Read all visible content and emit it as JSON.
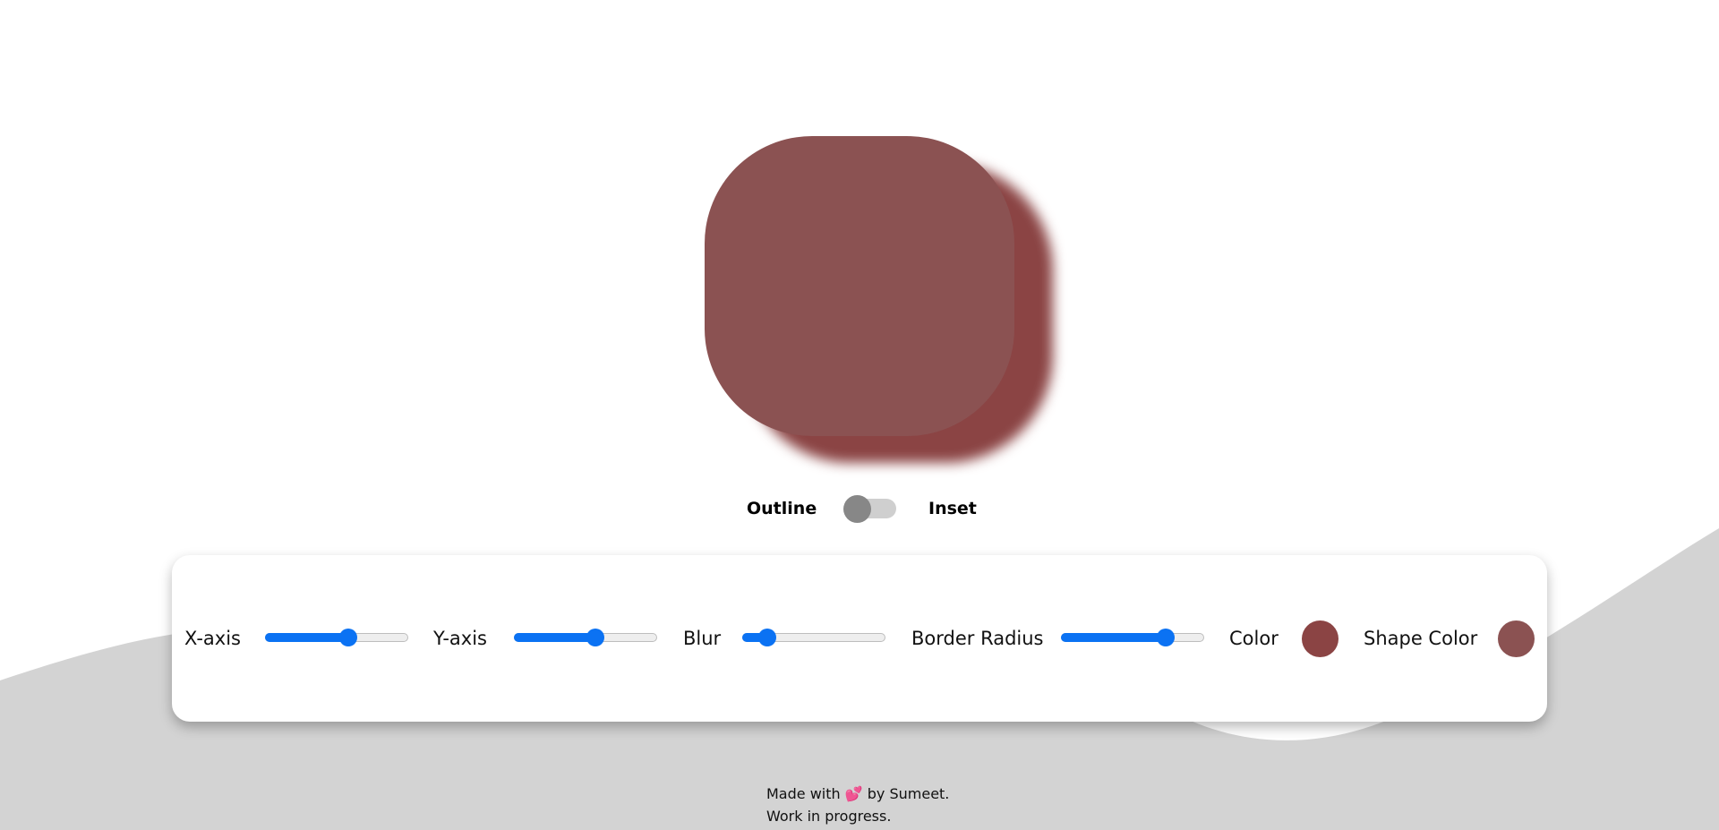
{
  "preview": {
    "shape_color": "#8b5252",
    "shadow_color": "#8b4444",
    "shadow_mode": "outline"
  },
  "toggle": {
    "left_label": "Outline",
    "right_label": "Inset",
    "state": "off"
  },
  "controls": {
    "x_axis": {
      "label": "X-axis",
      "value_fraction": 0.58
    },
    "y_axis": {
      "label": "Y-axis",
      "value_fraction": 0.57
    },
    "blur": {
      "label": "Blur",
      "value_fraction": 0.13
    },
    "border_radius": {
      "label": "Border Radius",
      "value_fraction": 0.75
    },
    "color": {
      "label": "Color",
      "value": "#8b4444"
    },
    "shape_color": {
      "label": "Shape Color",
      "value": "#8b5252"
    }
  },
  "colors": {
    "accent": "#0b72f3",
    "background_wave": "#d3d3d3",
    "panel": "#ffffff"
  },
  "footer": {
    "line1_prefix": "Made with",
    "heart_icon": "💕",
    "line1_suffix": "by Sumeet.",
    "line2": "Work in progress."
  }
}
